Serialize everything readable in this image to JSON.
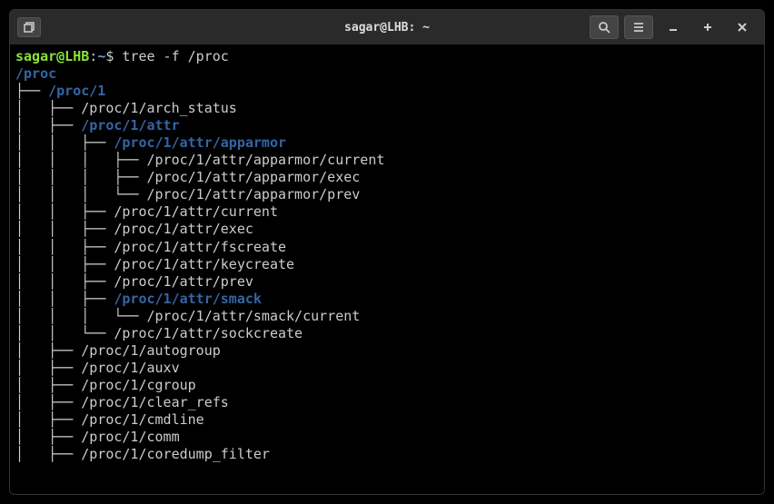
{
  "titlebar": {
    "title": "sagar@LHB: ~"
  },
  "prompt": {
    "user_host": "sagar@LHB",
    "separator1": ":",
    "path": "~",
    "separator2": "$ ",
    "command": "tree -f /proc"
  },
  "tree": {
    "root": "/proc",
    "lines": [
      {
        "prefix": "├── ",
        "indent": 0,
        "text": "/proc/1",
        "dir": true
      },
      {
        "prefix": "├── ",
        "indent": 1,
        "text": "/proc/1/arch_status",
        "dir": false
      },
      {
        "prefix": "├── ",
        "indent": 1,
        "text": "/proc/1/attr",
        "dir": true
      },
      {
        "prefix": "├── ",
        "indent": 2,
        "text": "/proc/1/attr/apparmor",
        "dir": true
      },
      {
        "prefix": "├── ",
        "indent": 3,
        "text": "/proc/1/attr/apparmor/current",
        "dir": false
      },
      {
        "prefix": "├── ",
        "indent": 3,
        "text": "/proc/1/attr/apparmor/exec",
        "dir": false
      },
      {
        "prefix": "└── ",
        "indent": 3,
        "text": "/proc/1/attr/apparmor/prev",
        "dir": false
      },
      {
        "prefix": "├── ",
        "indent": 2,
        "text": "/proc/1/attr/current",
        "dir": false
      },
      {
        "prefix": "├── ",
        "indent": 2,
        "text": "/proc/1/attr/exec",
        "dir": false
      },
      {
        "prefix": "├── ",
        "indent": 2,
        "text": "/proc/1/attr/fscreate",
        "dir": false
      },
      {
        "prefix": "├── ",
        "indent": 2,
        "text": "/proc/1/attr/keycreate",
        "dir": false
      },
      {
        "prefix": "├── ",
        "indent": 2,
        "text": "/proc/1/attr/prev",
        "dir": false
      },
      {
        "prefix": "├── ",
        "indent": 2,
        "text": "/proc/1/attr/smack",
        "dir": true
      },
      {
        "prefix": "└── ",
        "indent": 3,
        "text": "/proc/1/attr/smack/current",
        "dir": false
      },
      {
        "prefix": "└── ",
        "indent": 2,
        "text": "/proc/1/attr/sockcreate",
        "dir": false
      },
      {
        "prefix": "├── ",
        "indent": 1,
        "text": "/proc/1/autogroup",
        "dir": false
      },
      {
        "prefix": "├── ",
        "indent": 1,
        "text": "/proc/1/auxv",
        "dir": false
      },
      {
        "prefix": "├── ",
        "indent": 1,
        "text": "/proc/1/cgroup",
        "dir": false
      },
      {
        "prefix": "├── ",
        "indent": 1,
        "text": "/proc/1/clear_refs",
        "dir": false
      },
      {
        "prefix": "├── ",
        "indent": 1,
        "text": "/proc/1/cmdline",
        "dir": false
      },
      {
        "prefix": "├── ",
        "indent": 1,
        "text": "/proc/1/comm",
        "dir": false
      },
      {
        "prefix": "├── ",
        "indent": 1,
        "text": "/proc/1/coredump_filter",
        "dir": false
      }
    ]
  }
}
